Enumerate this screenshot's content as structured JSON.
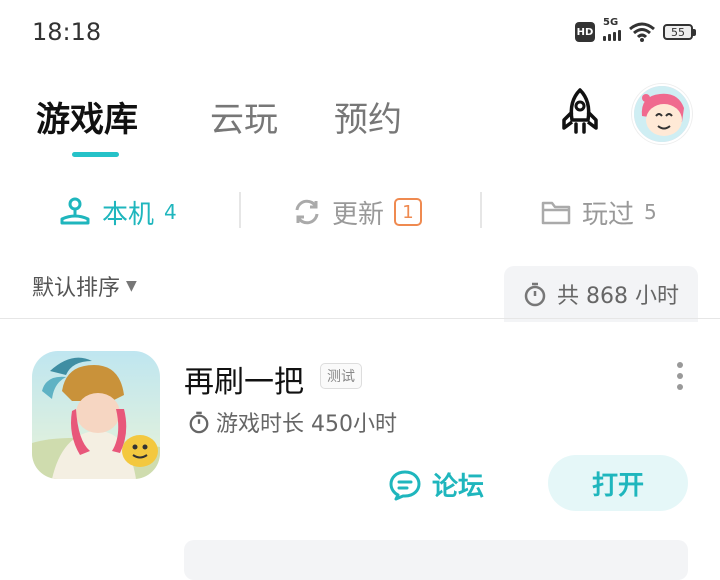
{
  "status_bar": {
    "time": "18:18",
    "hd_label": "HD",
    "network_label": "5G",
    "battery_level": "55"
  },
  "top_tabs": [
    {
      "label": "游戏库",
      "active": true
    },
    {
      "label": "云玩",
      "active": false
    },
    {
      "label": "预约",
      "active": false
    }
  ],
  "header_icons": [
    "rocket-icon",
    "avatar"
  ],
  "sub_tabs": [
    {
      "label": "本机",
      "count": "4",
      "icon": "joystick-icon",
      "active": true
    },
    {
      "label": "更新",
      "badge": "1",
      "icon": "refresh-icon",
      "active": false
    },
    {
      "label": "玩过",
      "count": "5",
      "icon": "folder-icon",
      "active": false
    }
  ],
  "sort": {
    "label": "默认排序"
  },
  "total_time": {
    "label": "共 868 小时"
  },
  "games": [
    {
      "title": "再刷一把",
      "tag": "测试",
      "playtime": "游戏时长 450小时",
      "forum_label": "论坛",
      "open_label": "打开"
    }
  ],
  "colors": {
    "accent": "#1fb6bd",
    "badge": "#ef8a50",
    "text_primary": "#111111",
    "text_secondary": "#777777"
  }
}
